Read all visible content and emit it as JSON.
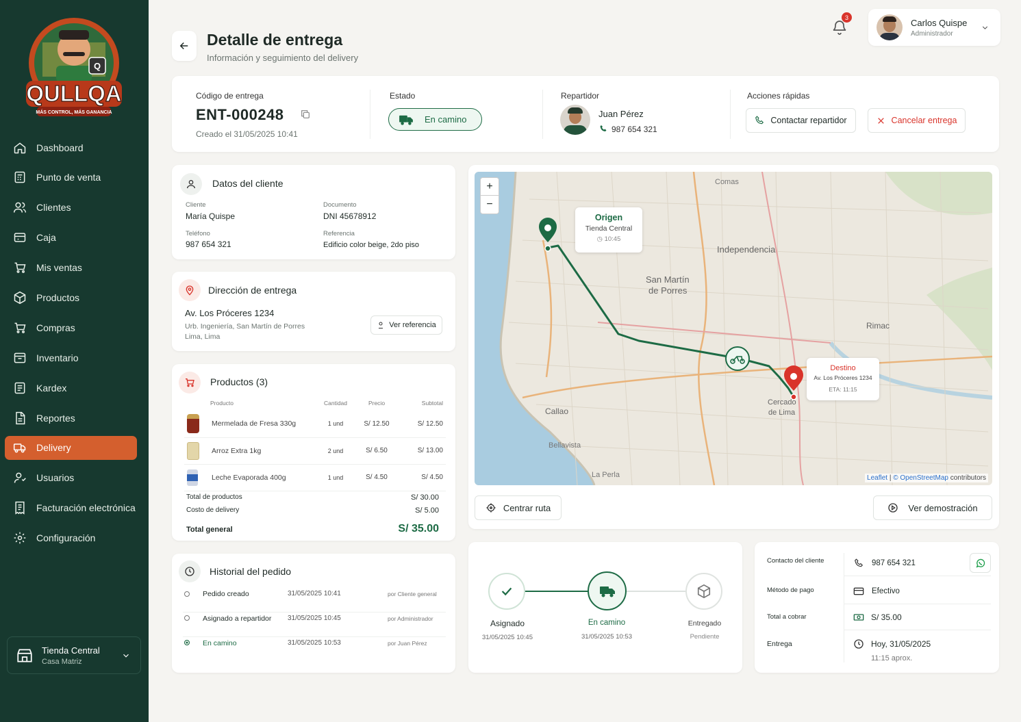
{
  "brand": {
    "name": "QULLQA",
    "tagline": "MÁS CONTROL, MÁS GANANCIA"
  },
  "sidebar": {
    "items": [
      {
        "label": "Dashboard",
        "icon": "home-icon"
      },
      {
        "label": "Punto de venta",
        "icon": "pos-icon"
      },
      {
        "label": "Clientes",
        "icon": "users-icon"
      },
      {
        "label": "Caja",
        "icon": "cash-register-icon"
      },
      {
        "label": "Mis ventas",
        "icon": "cart-icon"
      },
      {
        "label": "Productos",
        "icon": "box-icon"
      },
      {
        "label": "Compras",
        "icon": "cart-icon"
      },
      {
        "label": "Inventario",
        "icon": "inventory-icon"
      },
      {
        "label": "Kardex",
        "icon": "list-icon"
      },
      {
        "label": "Reportes",
        "icon": "report-icon"
      },
      {
        "label": "Delivery",
        "icon": "delivery-icon",
        "active": true
      },
      {
        "label": "Usuarios",
        "icon": "user-cog-icon"
      },
      {
        "label": "Facturación electrónica",
        "icon": "invoice-icon"
      },
      {
        "label": "Configuración",
        "icon": "gear-icon"
      }
    ],
    "store": {
      "name": "Tienda Central",
      "sub": "Casa Matriz"
    }
  },
  "header": {
    "title": "Detalle de entrega",
    "subtitle": "Información y seguimiento del delivery",
    "notifications": "3",
    "user": {
      "name": "Carlos Quispe",
      "role": "Administrador"
    }
  },
  "summary": {
    "code_label": "Código de entrega",
    "code": "ENT-000248",
    "created": "Creado el 31/05/2025 10:41",
    "status_label": "Estado",
    "status": "En camino",
    "courier_label": "Repartidor",
    "courier_name": "Juan Pérez",
    "courier_phone": "987 654 321",
    "actions_label": "Acciones rápidas",
    "contact_btn": "Contactar repartidor",
    "cancel_btn": "Cancelar entrega"
  },
  "client": {
    "title": "Datos del cliente",
    "cliente_label": "Cliente",
    "cliente": "María Quispe",
    "doc_label": "Documento",
    "doc": "DNI 45678912",
    "phone_label": "Teléfono",
    "phone": "987 654 321",
    "ref_label": "Referencia",
    "ref": "Edificio color beige, 2do piso"
  },
  "address": {
    "title": "Dirección de entrega",
    "line1": "Av. Los Próceres 1234",
    "line2": "Urb. Ingeniería, San Martín de Porres",
    "line3": "Lima, Lima",
    "ref_btn": "Ver referencia"
  },
  "products": {
    "title": "Productos (3)",
    "headers": [
      "Producto",
      "Cantidad",
      "Precio",
      "Subtotal"
    ],
    "rows": [
      {
        "name": "Mermelada de Fresa 330g",
        "qty": "1 und",
        "price": "S/ 12.50",
        "subtotal": "S/ 12.50"
      },
      {
        "name": "Arroz Extra 1kg",
        "qty": "2 und",
        "price": "S/ 6.50",
        "subtotal": "S/ 13.00"
      },
      {
        "name": "Leche Evaporada 400g",
        "qty": "1 und",
        "price": "S/ 4.50",
        "subtotal": "S/ 4.50"
      }
    ],
    "total_products_label": "Total de productos",
    "total_products": "S/ 30.00",
    "delivery_cost_label": "Costo de delivery",
    "delivery_cost": "S/ 5.00",
    "grand_total_label": "Total general",
    "grand_total": "S/ 35.00"
  },
  "history": {
    "title": "Historial del pedido",
    "rows": [
      {
        "event": "Pedido creado",
        "time": "31/05/2025 10:41",
        "by": "por Cliente general"
      },
      {
        "event": "Asignado a repartidor",
        "time": "31/05/2025 10:45",
        "by": "por Administrador"
      },
      {
        "event": "En camino",
        "time": "31/05/2025 10:53",
        "by": "por Juan Pérez"
      }
    ]
  },
  "map": {
    "origin_title": "Origen",
    "origin_sub": "Tienda Central",
    "origin_time": "10:45",
    "dest_title": "Destino",
    "dest_sub": "Av. Los Próceres 1234",
    "dest_eta": "ETA: 11:15",
    "places": [
      "Comas",
      "Independencia",
      "San Martín",
      "de Porres",
      "Rimac",
      "Callao",
      "Cercado",
      "de Lima",
      "Bellavista",
      "La Perla"
    ],
    "attribution_leaflet": "Leaflet",
    "attribution_osm": "© OpenStreetMap",
    "attribution_rest": "contributors",
    "center_btn": "Centrar ruta",
    "demo_btn": "Ver demostración"
  },
  "progress": {
    "steps": [
      {
        "label": "Asignado",
        "time": "31/05/2025 10:45"
      },
      {
        "label": "En camino",
        "time": "31/05/2025 10:53"
      },
      {
        "label": "Entregado",
        "time": "Pendiente"
      }
    ]
  },
  "contact_info": {
    "rows": [
      {
        "label": "Contacto del cliente",
        "value": "987 654 321"
      },
      {
        "label": "Método de pago",
        "value": "Efectivo"
      },
      {
        "label": "Total a cobrar",
        "value": "S/ 35.00"
      },
      {
        "label": "Entrega",
        "value": "Hoy, 31/05/2025",
        "value2": "11:15 aprox."
      }
    ]
  },
  "colors": {
    "primary": "#17392f",
    "accent": "#d45f2e",
    "green": "#1d6b45",
    "red": "#d9342b"
  }
}
